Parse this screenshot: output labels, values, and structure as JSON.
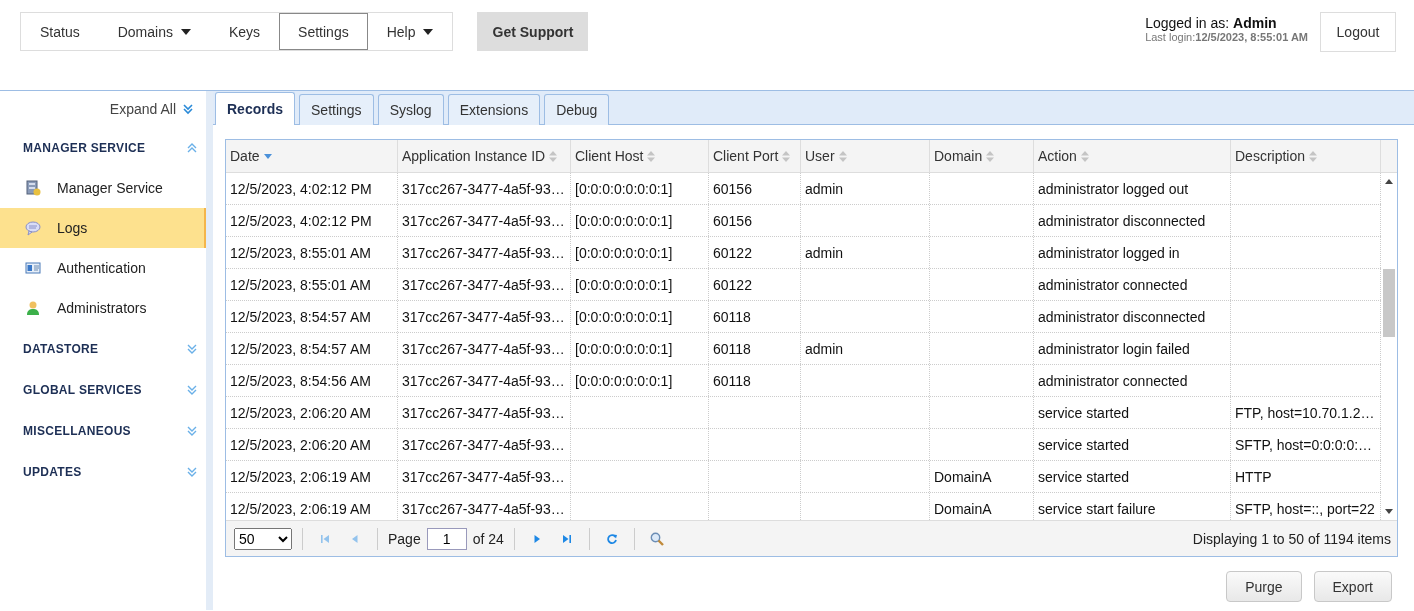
{
  "nav": {
    "items": [
      {
        "label": "Status",
        "dropdown": false,
        "selected": false
      },
      {
        "label": "Domains",
        "dropdown": true,
        "selected": false
      },
      {
        "label": "Keys",
        "dropdown": false,
        "selected": false
      },
      {
        "label": "Settings",
        "dropdown": false,
        "selected": true
      },
      {
        "label": "Help",
        "dropdown": true,
        "selected": false
      }
    ],
    "support_button": "Get Support"
  },
  "user": {
    "prefix": "Logged in as:",
    "name": "Admin",
    "last_login_label": "Last login:",
    "last_login": "12/5/2023, 8:55:01 AM",
    "logout": "Logout"
  },
  "sidebar": {
    "expand_all": "Expand All",
    "sections": [
      {
        "title": "MANAGER SERVICE",
        "expanded": true,
        "items": [
          {
            "label": "Manager Service",
            "kind": "server",
            "selected": false
          },
          {
            "label": "Logs",
            "kind": "chat",
            "selected": true
          },
          {
            "label": "Authentication",
            "kind": "card",
            "selected": false
          },
          {
            "label": "Administrators",
            "kind": "person",
            "selected": false
          }
        ]
      },
      {
        "title": "DATASTORE",
        "expanded": false
      },
      {
        "title": "GLOBAL SERVICES",
        "expanded": false
      },
      {
        "title": "MISCELLANEOUS",
        "expanded": false
      },
      {
        "title": "UPDATES",
        "expanded": false
      }
    ]
  },
  "tabs": [
    {
      "label": "Records",
      "selected": true
    },
    {
      "label": "Settings",
      "selected": false
    },
    {
      "label": "Syslog",
      "selected": false
    },
    {
      "label": "Extensions",
      "selected": false
    },
    {
      "label": "Debug",
      "selected": false
    }
  ],
  "table": {
    "columns": [
      {
        "label": "Date",
        "sorted": true
      },
      {
        "label": "Application Instance ID",
        "sorted": false
      },
      {
        "label": "Client Host",
        "sorted": false
      },
      {
        "label": "Client Port",
        "sorted": false
      },
      {
        "label": "User",
        "sorted": false
      },
      {
        "label": "Domain",
        "sorted": false
      },
      {
        "label": "Action",
        "sorted": false
      },
      {
        "label": "Description",
        "sorted": false
      }
    ],
    "rows": [
      [
        "12/5/2023, 4:02:12 PM",
        "317cc267-3477-4a5f-93…",
        "[0:0:0:0:0:0:0:1]",
        "60156",
        "admin",
        "",
        "administrator logged out",
        ""
      ],
      [
        "12/5/2023, 4:02:12 PM",
        "317cc267-3477-4a5f-93…",
        "[0:0:0:0:0:0:0:1]",
        "60156",
        "",
        "",
        "administrator disconnected",
        ""
      ],
      [
        "12/5/2023, 8:55:01 AM",
        "317cc267-3477-4a5f-93…",
        "[0:0:0:0:0:0:0:1]",
        "60122",
        "admin",
        "",
        "administrator logged in",
        ""
      ],
      [
        "12/5/2023, 8:55:01 AM",
        "317cc267-3477-4a5f-93…",
        "[0:0:0:0:0:0:0:1]",
        "60122",
        "",
        "",
        "administrator connected",
        ""
      ],
      [
        "12/5/2023, 8:54:57 AM",
        "317cc267-3477-4a5f-93…",
        "[0:0:0:0:0:0:0:1]",
        "60118",
        "",
        "",
        "administrator disconnected",
        ""
      ],
      [
        "12/5/2023, 8:54:57 AM",
        "317cc267-3477-4a5f-93…",
        "[0:0:0:0:0:0:0:1]",
        "60118",
        "admin",
        "",
        "administrator login failed",
        ""
      ],
      [
        "12/5/2023, 8:54:56 AM",
        "317cc267-3477-4a5f-93…",
        "[0:0:0:0:0:0:0:1]",
        "60118",
        "",
        "",
        "administrator connected",
        ""
      ],
      [
        "12/5/2023, 2:06:20 AM",
        "317cc267-3477-4a5f-93…",
        "",
        "",
        "",
        "",
        "service started",
        "FTP, host=10.70.1.2…"
      ],
      [
        "12/5/2023, 2:06:20 AM",
        "317cc267-3477-4a5f-93…",
        "",
        "",
        "",
        "",
        "service started",
        "SFTP, host=0:0:0:0:…"
      ],
      [
        "12/5/2023, 2:06:19 AM",
        "317cc267-3477-4a5f-93…",
        "",
        "",
        "",
        "DomainA",
        "service started",
        "HTTP"
      ],
      [
        "12/5/2023, 2:06:19 AM",
        "317cc267-3477-4a5f-93…",
        "",
        "",
        "",
        "DomainA",
        "service start failure",
        "SFTP, host=::, port=22"
      ]
    ]
  },
  "pager": {
    "page_size": "50",
    "controls": [
      {
        "kind": "first",
        "disabled": true
      },
      {
        "kind": "prev",
        "disabled": true
      },
      {
        "kind": "page"
      },
      {
        "kind": "next",
        "disabled": false
      },
      {
        "kind": "last",
        "disabled": false
      },
      {
        "kind": "refresh",
        "disabled": false
      },
      {
        "kind": "search",
        "disabled": false
      }
    ],
    "page_label": "Page",
    "page": "1",
    "of_label": "of 24",
    "summary": "Displaying 1 to 50 of 1194 items"
  },
  "buttons": [
    "Purge",
    "Export"
  ]
}
